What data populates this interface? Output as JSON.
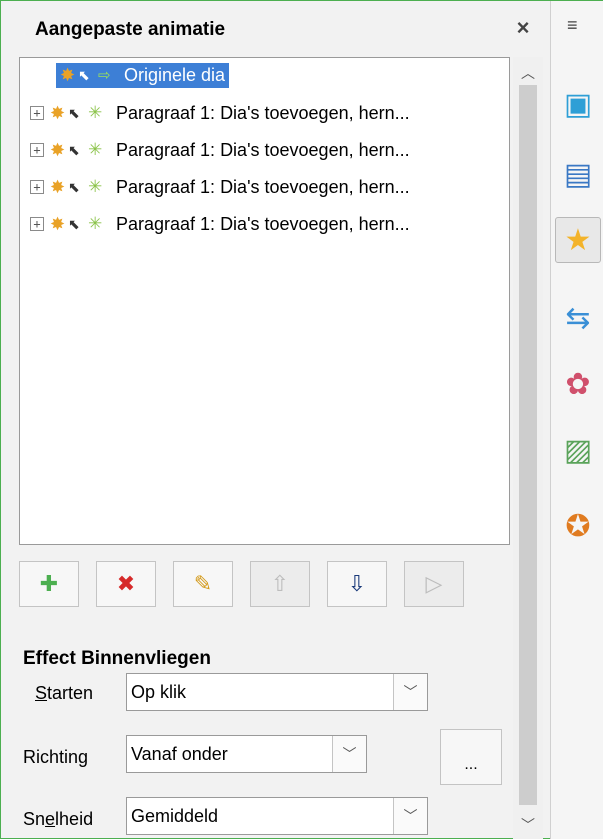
{
  "panel": {
    "title": "Aangepaste animatie",
    "close_icon": "×",
    "menu_icon": "≡"
  },
  "tree": {
    "items": [
      {
        "label": "Originele dia",
        "selected": true,
        "expandable": false
      },
      {
        "label": "Paragraaf 1: Dia's toevoegen, hern...",
        "selected": false,
        "expandable": true
      },
      {
        "label": "Paragraaf 1: Dia's toevoegen, hern...",
        "selected": false,
        "expandable": true
      },
      {
        "label": "Paragraaf 1: Dia's toevoegen, hern...",
        "selected": false,
        "expandable": true
      },
      {
        "label": "Paragraaf 1: Dia's toevoegen, hern...",
        "selected": false,
        "expandable": true
      }
    ],
    "expander_glyph": "+"
  },
  "toolbar": {
    "add_glyph": "✚",
    "remove_glyph": "✖",
    "edit_glyph": "✎",
    "up_glyph": "⇧",
    "down_glyph": "⇩",
    "play_glyph": "▷"
  },
  "effect": {
    "section_title": "Effect Binnenvliegen",
    "start_label_u": "S",
    "start_label_rest": "tarten",
    "start_value": "Op klik",
    "direction_label": "Richting",
    "direction_value": "Vanaf onder",
    "speed_label_a": "Sn",
    "speed_label_u": "e",
    "speed_label_b": "lheid",
    "speed_value": "Gemiddeld",
    "more_label": "..."
  },
  "sidebar": {
    "buttons": [
      {
        "name": "properties",
        "icon": "cube-icon",
        "glyph": "▣",
        "color": "#2e9fd6"
      },
      {
        "name": "master-slides",
        "icon": "slides-icon",
        "glyph": "▤",
        "color": "#3a78c4"
      },
      {
        "name": "custom-animation",
        "icon": "star-icon",
        "glyph": "★",
        "color": "#f3b32a",
        "active": true
      },
      {
        "name": "slide-transition",
        "icon": "transition-icon",
        "glyph": "⇆",
        "color": "#3a8fd6"
      },
      {
        "name": "styles",
        "icon": "styles-icon",
        "glyph": "✿",
        "color": "#d0506c"
      },
      {
        "name": "gallery",
        "icon": "gallery-icon",
        "glyph": "▨",
        "color": "#5aa35a"
      },
      {
        "name": "navigator",
        "icon": "compass-icon",
        "glyph": "✪",
        "color": "#e07b20"
      }
    ]
  },
  "colors": {
    "selection": "#3d7fd6",
    "frame_border": "#4caf50"
  }
}
